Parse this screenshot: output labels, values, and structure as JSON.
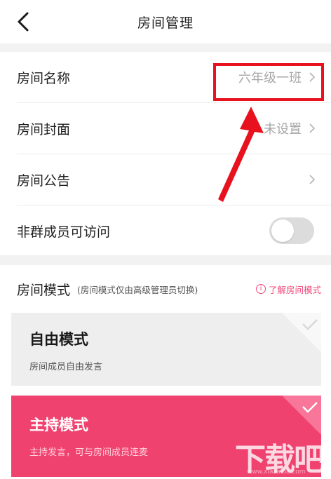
{
  "header": {
    "title": "房间管理",
    "back_icon": "chevron-left-icon"
  },
  "settings": {
    "room_name": {
      "label": "房间名称",
      "value": "六年级一班"
    },
    "room_cover": {
      "label": "房间封面",
      "value": "未设置"
    },
    "room_notice": {
      "label": "房间公告",
      "value": ""
    },
    "non_member_access": {
      "label": "非群成员可访问",
      "enabled": false
    }
  },
  "mode": {
    "title": "房间模式",
    "note": "(房间模式仅由高级管理员切换)",
    "learn_more": "了解房间模式",
    "options": [
      {
        "title": "自由模式",
        "subtitle": "房间成员自由发言",
        "selected": false
      },
      {
        "title": "主持模式",
        "subtitle": "主持发言，可与房间成员连麦",
        "selected": true
      }
    ]
  },
  "colors": {
    "accent": "#f0426f",
    "annotation": "#e8121f",
    "toggle_off": "#dcdcdc"
  },
  "watermark": {
    "text": "下载吧",
    "url": "www.xiazaiba.com"
  }
}
